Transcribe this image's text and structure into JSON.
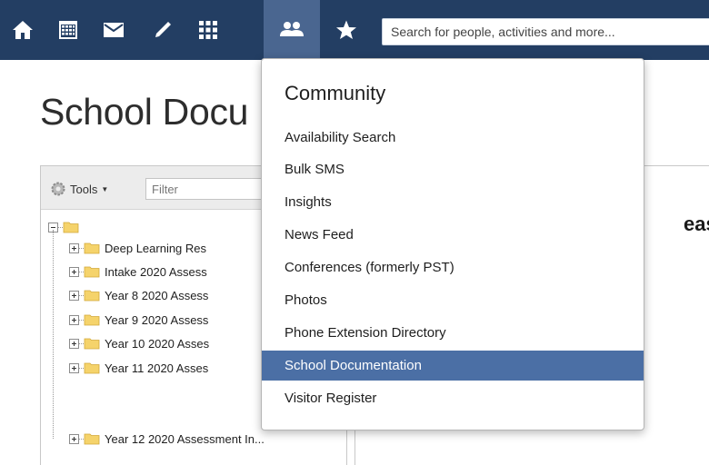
{
  "nav": {
    "icons": [
      "home-icon",
      "calendar-icon",
      "mail-icon",
      "pencil-icon",
      "grid-icon",
      "people-icon",
      "star-icon"
    ],
    "active_icon": "people-icon",
    "search_placeholder": "Search for people, activities and more..."
  },
  "page": {
    "title": "School Docu"
  },
  "tree": {
    "tools_label": "Tools",
    "filter_placeholder": "Filter",
    "items": [
      "Deep Learning Res",
      "Intake 2020 Assess",
      "Year 8 2020 Assess",
      "Year 9 2020 Assess",
      "Year 10 2020 Asses",
      "Year 11 2020 Asses",
      "Year 12 2020 Assessment In..."
    ]
  },
  "right": {
    "heading_fragment": "ease"
  },
  "menu": {
    "title": "Community",
    "items": [
      "Availability Search",
      "Bulk SMS",
      "Insights",
      "News Feed",
      "Conferences (formerly PST)",
      "Photos",
      "Phone Extension Directory",
      "School Documentation",
      "Visitor Register"
    ],
    "selected": "School Documentation"
  },
  "colors": {
    "nav_bg": "#233e63",
    "nav_active_bg": "#4a6690",
    "menu_selected_bg": "#4b6fa5",
    "folder_yellow": "#f2c94c"
  }
}
